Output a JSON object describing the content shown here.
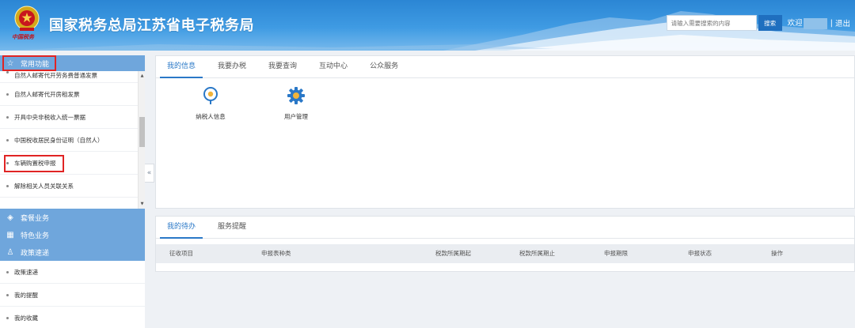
{
  "header": {
    "logo_text": "中国税务",
    "site_title": "国家税务总局江苏省电子税务局",
    "search_placeholder": "请输入需要搜索的内容",
    "search_button": "搜索",
    "welcome": "欢迎",
    "separator": "|",
    "logout": "退出"
  },
  "sidebar": {
    "common_title": "常用功能",
    "common_items": [
      "自然人邮寄代开劳务费普通发票",
      "自然人邮寄代开房租发票",
      "开具中央非税收入统一票据",
      "中国税收居民身份证明（自然人）",
      "车辆购置税申报",
      "解除相关人员关联关系"
    ],
    "group_package": "套餐业务",
    "group_special": "特色业务",
    "group_policy": "政策速递",
    "policy_items": [
      "政策速递",
      "我的提醒",
      "我的收藏"
    ],
    "scroll_up": "▲",
    "scroll_down": "▼",
    "collapse": "«"
  },
  "top_panel": {
    "tabs": [
      "我的信息",
      "我要办税",
      "我要查询",
      "互动中心",
      "公众服务"
    ],
    "tiles": [
      {
        "label": "纳税人信息",
        "icon": "taxpayer-info-icon"
      },
      {
        "label": "用户管理",
        "icon": "user-management-gear-icon"
      }
    ]
  },
  "bottom_panel": {
    "tabs": [
      "我的待办",
      "服务提醒"
    ],
    "columns": [
      "征收项目",
      "申报表种类",
      "税款所属期起",
      "税款所属期止",
      "申报期限",
      "申报状态",
      "操作"
    ]
  },
  "colors": {
    "accent": "#2a78c7",
    "sidebar_header": "#6fa6dc",
    "highlight_box": "#e02424"
  }
}
